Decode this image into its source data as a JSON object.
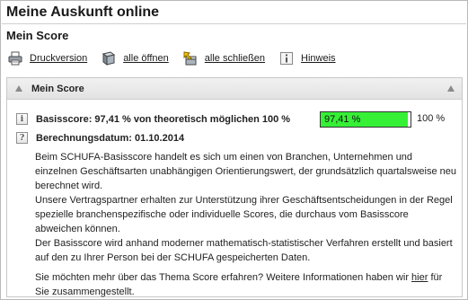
{
  "header": {
    "app_title": "Meine Auskunft online",
    "page_title": "Mein Score"
  },
  "toolbar": {
    "items": [
      {
        "label": "Druckversion",
        "icon": "printer-icon"
      },
      {
        "label": "alle öffnen",
        "icon": "open-all-icon"
      },
      {
        "label": "alle schließen",
        "icon": "close-all-icon"
      },
      {
        "label": "Hinweis",
        "icon": "info-icon"
      }
    ]
  },
  "panel": {
    "title": "Mein Score",
    "basisscore_label": "Basisscore: 97,41 % von theoretisch möglichen 100 %",
    "bar_value_text": "97,41 %",
    "bar_fraction": 0.9741,
    "bar_max_text": "100 %",
    "bar_color": "#36f036",
    "date_label": "Berechnungsdatum: 01.10.2014",
    "paragraphs": [
      "Beim SCHUFA-Basisscore handelt es sich um einen von Branchen, Unternehmen und einzelnen Geschäftsarten unabhängigen Orientierungswert, der grundsätzlich quartalsweise neu berechnet wird.",
      "Unsere Vertragspartner erhalten zur Unterstützung ihrer Geschäftsentscheidungen in der Regel spezielle branchenspezifische oder individuelle Scores, die durchaus vom Basisscore abweichen können.",
      "Der Basisscore wird anhand moderner mathematisch-statistischer Verfahren erstellt und basiert auf den zu Ihrer Person bei der SCHUFA gespeicherten Daten."
    ],
    "more_info_before": "Sie möchten mehr über das Thema Score erfahren? Weitere Informationen haben wir ",
    "more_info_link": "hier",
    "more_info_after": " für Sie zusammengestellt."
  }
}
